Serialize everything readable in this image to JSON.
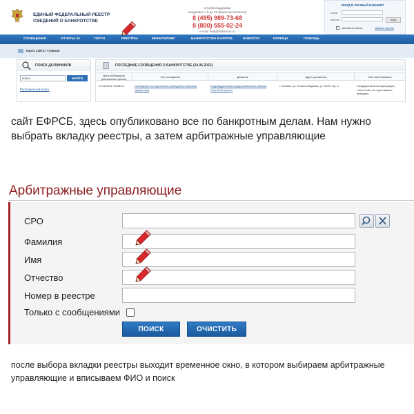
{
  "site": {
    "title_line1": "ЕДИНЫЙ ФЕДЕРАЛЬНЫЙ РЕЕСТР",
    "title_line2": "СВЕДЕНИЙ О БАНКРОТСТВЕ",
    "contact_line1": "служба поддержки",
    "contact_line2": "ежедневно с 8 до 20 (время московское)",
    "phone1": "8 (495) 989-73-68",
    "phone2": "8 (800) 555-02-24",
    "contact_email": "e-mail: help@fedresurs.ru"
  },
  "login": {
    "title": "ВХОД В ЛИЧНЫЙ КАБИНЕТ",
    "login_label": "логин",
    "password_label": "пароль",
    "go_label": "вход",
    "remember_label": "запомнить меня",
    "register_label": "забыли пароль"
  },
  "nav": {
    "items": [
      "Сообщения",
      "Отчеты АУ",
      "Торги",
      "Реестры",
      "Мониторинг",
      "Банкротство в ЕФРСБ",
      "Новости",
      "Юрлица",
      "Помощь"
    ]
  },
  "breadcrumb": {
    "text": "Карта сайта / Главная"
  },
  "debtor_search": {
    "title": "ПОИСК ДОЛЖНИКОВ",
    "input_value": "поиск",
    "button_label": "НАЙТИ",
    "extended_link": "Расширенный поиск"
  },
  "messages": {
    "title": "ПОСЛЕДНИЕ СООБЩЕНИЯ О БАНКРОТСТВЕ (24.06.2022)",
    "columns": [
      "Дата публикации (московское время)",
      "Тип сообщения",
      "Должник",
      "Адрес должника",
      "Кем опубликовано"
    ],
    "row": {
      "date": "24.06.2022 15:55:54",
      "type": "Сообщение о результатах проведения собрания кредиторов",
      "debtor": "Индивидуальный предприниматель Иванов Сергей Петрович",
      "address": "г. Москва, ул. Новослободская, д. 14/19, стр. 1",
      "publisher": "Государственная корпорация «Агентство по страхованию вкладов»"
    }
  },
  "caption1": "сайт ЕФРСБ, здесь опубликовано все по банкротным делам. Нам нужно выбрать вкладку реестры, а затем арбитражные управляющие",
  "form": {
    "title": "Арбитражные управляющие",
    "fields": [
      {
        "label": "СРО",
        "value": ""
      },
      {
        "label": "Фамилия",
        "value": ""
      },
      {
        "label": "Имя",
        "value": ""
      },
      {
        "label": "Отчество",
        "value": ""
      },
      {
        "label": "Номер в реестре",
        "value": ""
      }
    ],
    "only_messages_label": "Только с сообщениями",
    "only_messages_checked": false,
    "search_label": "ПОИСК",
    "clear_label": "ОЧИСТИТЬ"
  },
  "caption2": "после выбора вкладки реестры выходит временное окно, в котором выбираем арбитражные управляющие и вписываем ФИО и поиск",
  "colors": {
    "brand_blue": "#1f5c9d",
    "title_red": "#8c1c1c",
    "accent_red": "#a51f26",
    "phone_red": "#cf3b3b",
    "pencil_red": "#d8282b"
  },
  "icons": [
    "eagle-emblem-icon",
    "magnifier-icon",
    "document-icon",
    "search-icon",
    "clear-icon",
    "pencil-icon"
  ]
}
